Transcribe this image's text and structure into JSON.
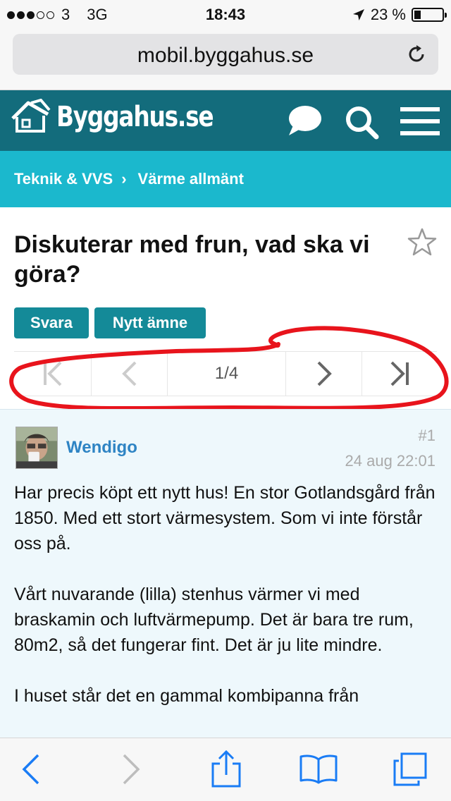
{
  "status_bar": {
    "carrier": "3",
    "network": "3G",
    "time": "18:43",
    "battery": "23 %",
    "battery_level": 0.23
  },
  "browser": {
    "url": "mobil.byggahus.se"
  },
  "site": {
    "logo_text": "Byggahus.se"
  },
  "breadcrumb": {
    "items": [
      "Teknik & VVS",
      "Värme allmänt"
    ],
    "separator": "›"
  },
  "thread": {
    "title": "Diskuterar med frun, vad ska vi göra?",
    "reply_button": "Svara",
    "new_topic_button": "Nytt ämne"
  },
  "pagination": {
    "label": "1/4",
    "current": 1,
    "total": 4
  },
  "post": {
    "username": "Wendigo",
    "number": "#1",
    "date": "24 aug 22:01",
    "paragraphs": [
      "Har precis köpt ett nytt hus! En stor Gotlandsgård från 1850. Med ett stort värmesystem. Som vi inte förstår oss på.",
      "Vårt nuvarande (lilla) stenhus värmer vi med braskamin och luftvärmepump. Det är bara tre rum, 80m2, så det fungerar fint. Det är ju lite mindre.",
      "I huset står det en gammal kombipanna från"
    ]
  },
  "colors": {
    "header": "#136c7c",
    "breadcrumb": "#1bb8cd",
    "button": "#148a98",
    "username": "#2e84c4",
    "annotation": "#e8141c",
    "ios_blue": "#1a7cf5"
  }
}
